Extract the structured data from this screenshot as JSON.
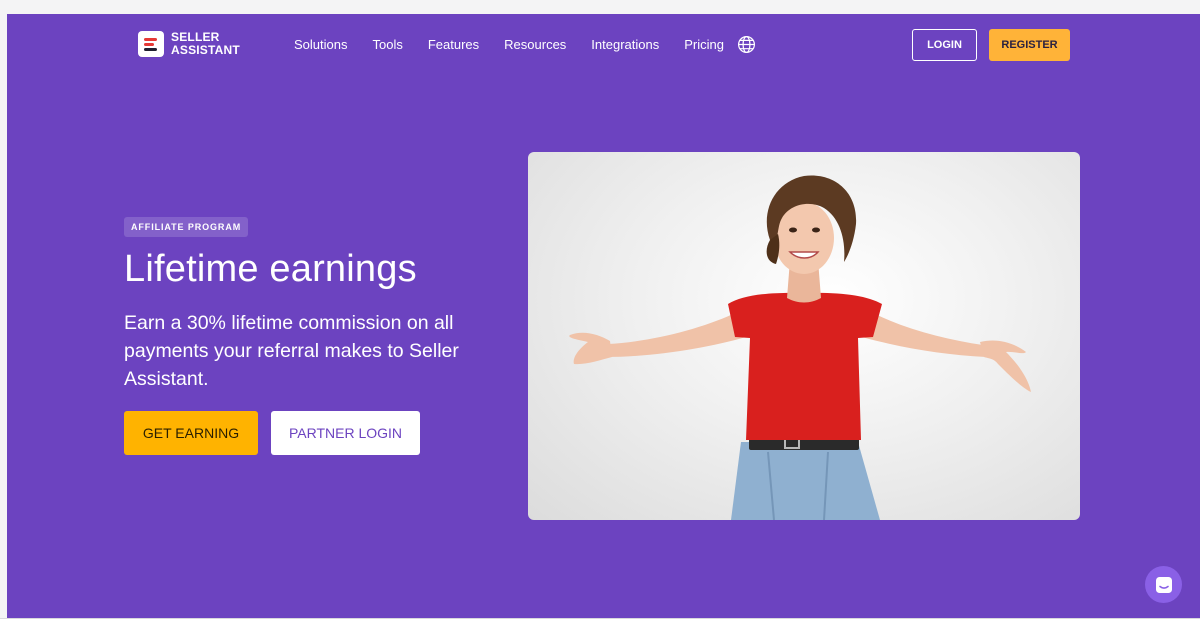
{
  "brand": {
    "line1": "SELLER",
    "line2": "ASSISTANT"
  },
  "nav": {
    "items": [
      "Solutions",
      "Tools",
      "Features",
      "Resources",
      "Integrations",
      "Pricing"
    ],
    "language_icon": "globe-icon"
  },
  "header": {
    "login_label": "LOGIN",
    "register_label": "REGISTER"
  },
  "hero": {
    "badge": "AFFILIATE PROGRAM",
    "title": "Lifetime earnings",
    "subtitle": "Earn a 30% lifetime commission on all payments your referral makes to Seller Assistant.",
    "primary_cta": "GET EARNING",
    "secondary_cta": "PARTNER LOGIN"
  },
  "colors": {
    "background": "#6c43c0",
    "accent": "#ffb300",
    "register": "#ffb338",
    "chat": "#8a60e6"
  },
  "chat_widget_icon": "chat-icon"
}
